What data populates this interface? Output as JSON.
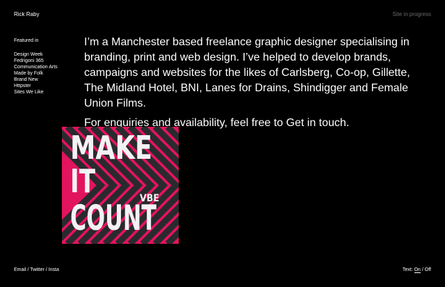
{
  "header": {
    "site_name": "Rick Raby",
    "status": "Site in progress"
  },
  "featured": {
    "heading": "Featured in",
    "items": [
      "Design Week",
      "Fedrigoni 365",
      "Communication Arts",
      "Made by Folk",
      "Brand New",
      "Httpster",
      "Sites We Like"
    ]
  },
  "intro": {
    "paragraph": "I’m a Manchester based freelance graphic designer specialising in branding, print and web design. I’ve helped to develop brands, campaigns and websites for the likes of Carlsberg, Co-op, Gillette, The Midland Hotel, BNI, Lanes for Drains, Shindigger and Female Union Films.",
    "cta_prefix": "For enquiries and availability, feel free to ",
    "cta_link": "Get in touch",
    "cta_suffix": "."
  },
  "artwork": {
    "line1": "MAKE",
    "line2": "IT",
    "line3": "COUNT",
    "badge": "VBE",
    "colors": {
      "pink": "#e3145e",
      "dark": "#2a2a2e",
      "text": "#f2f2f2"
    }
  },
  "footer": {
    "email": "Email",
    "twitter": "Twitter",
    "insta": "Insta",
    "separator": " / ",
    "text_toggle_label": "Text:",
    "text_on": "On",
    "text_off": "Off"
  }
}
